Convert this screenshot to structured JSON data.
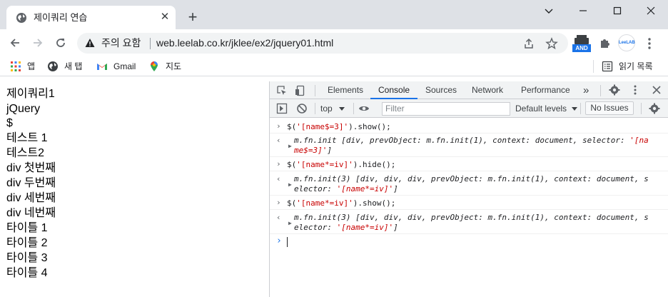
{
  "tab": {
    "title": "제이쿼리 연습",
    "close": "✕",
    "new_tab": "+"
  },
  "address": {
    "warning": "주의 요함",
    "url": "web.leelab.co.kr/jklee/ex2/jquery01.html"
  },
  "extensions": {
    "and_label": "AND",
    "leelab_label": "LeeLAB"
  },
  "bookmarks": {
    "items": [
      {
        "label": "앱",
        "icon": "apps-grid-icon"
      },
      {
        "label": "새 탭",
        "icon": "globe-icon"
      },
      {
        "label": "Gmail",
        "icon": "gmail-icon"
      },
      {
        "label": "지도",
        "icon": "maps-pin-icon"
      }
    ],
    "reading_list": "읽기 목록"
  },
  "page": {
    "lines": [
      "제이쿼리1",
      "jQuery",
      "$",
      "테스트 1",
      "테스트2",
      "div 첫번째",
      "div 두번째",
      "div 세번째",
      "div 네번째",
      "타이틀 1",
      "타이틀 2",
      "타이틀 3",
      "타이틀 4"
    ]
  },
  "devtools": {
    "tabs": [
      "Elements",
      "Console",
      "Sources",
      "Network",
      "Performance"
    ],
    "more_tabs": "»",
    "active_tab": "Console",
    "context": "top",
    "filter_placeholder": "Filter",
    "levels": "Default levels",
    "issues": "No Issues",
    "accent": "#1a73e8"
  },
  "console": {
    "entries": [
      {
        "input_a": "$(",
        "input_str": "'[name$=3]'",
        "input_b": ").show();",
        "out1": "m.fn.init [div, prevObject: m.fn.init(1), context: document, selector: ",
        "out1_str": "'[na",
        "out2_str": "me$=3]'",
        "out2": "]"
      },
      {
        "input_a": "$(",
        "input_str": "'[name*=iv]'",
        "input_b": ").hide();",
        "out1": "m.fn.init(3) [div, div, div, prevObject: m.fn.init(1), context: document, s",
        "out2a": "elector: ",
        "out2_str": "'[name*=iv]'",
        "out2": "]"
      },
      {
        "input_a": "$(",
        "input_str": "'[name*=iv]'",
        "input_b": ").show();",
        "out1": "m.fn.init(3) [div, div, div, prevObject: m.fn.init(1), context: document, s",
        "out2a": "elector: ",
        "out2_str": "'[name*=iv]'",
        "out2": "]"
      }
    ],
    "prompt": "›"
  }
}
